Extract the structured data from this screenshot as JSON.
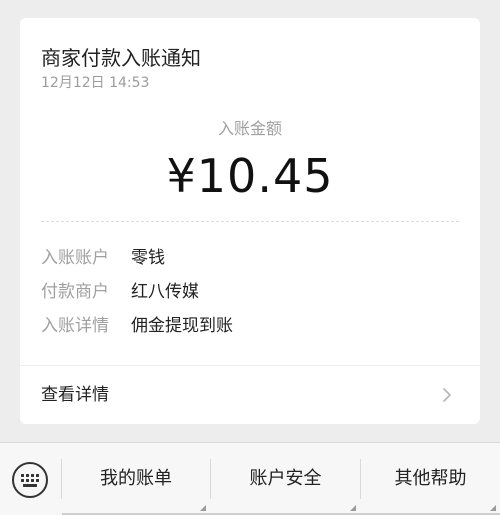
{
  "notification": {
    "title": "商家付款入账通知",
    "time": "12月12日  14:53",
    "amount_label": "入账金额",
    "amount": "¥10.45",
    "details": [
      {
        "key": "入账账户",
        "value": "零钱"
      },
      {
        "key": "付款商户",
        "value": "红八传媒"
      },
      {
        "key": "入账详情",
        "value": "佣金提现到账"
      }
    ],
    "view_details": "查看详情"
  },
  "menu": {
    "keyboard_icon": "keyboard-icon",
    "items": [
      {
        "label": "我的账单"
      },
      {
        "label": "账户安全"
      },
      {
        "label": "其他帮助"
      }
    ]
  },
  "colors": {
    "background": "#ededed",
    "card": "#ffffff",
    "text_primary": "#222222",
    "text_secondary": "#a0a0a0"
  }
}
